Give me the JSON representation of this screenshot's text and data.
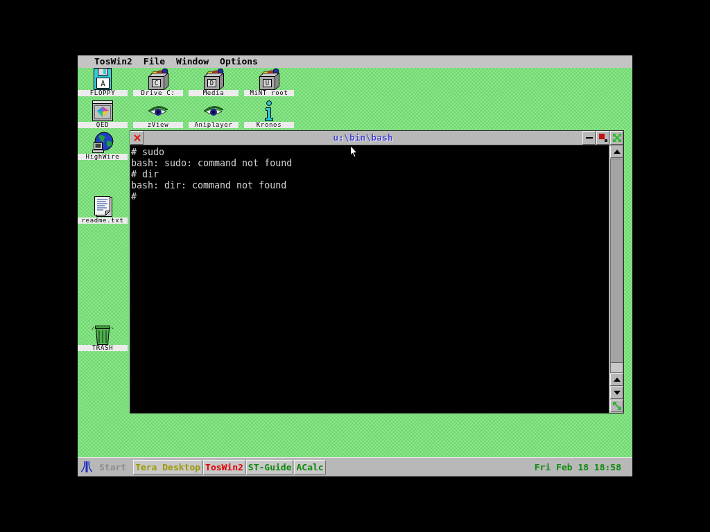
{
  "menu_bar": {
    "items": [
      "TosWin2",
      "File",
      "Window",
      "Options"
    ]
  },
  "desktop_icons": [
    {
      "label": "FLOPPY",
      "kind": "floppy",
      "letter": "A"
    },
    {
      "label": "Drive C:",
      "kind": "drive",
      "letter": "C"
    },
    {
      "label": "Media",
      "kind": "drive",
      "letter": "D"
    },
    {
      "label": "MiNT root",
      "kind": "drive",
      "letter": "U"
    },
    {
      "label": "QED",
      "kind": "editor"
    },
    {
      "label": "zView",
      "kind": "eye"
    },
    {
      "label": "Aniplayer",
      "kind": "eye"
    },
    {
      "label": "Kronos",
      "kind": "info"
    },
    {
      "label": "HighWire",
      "kind": "globe"
    },
    {
      "label": "readme.txt",
      "kind": "document"
    },
    {
      "label": "TRASH",
      "kind": "trash"
    }
  ],
  "window": {
    "title": "u:\\bin\\bash",
    "lines": [
      "# sudo",
      "bash: sudo: command not found",
      "# dir",
      "bash: dir: command not found",
      "#"
    ]
  },
  "taskbar": {
    "start": "Start",
    "tasks": [
      {
        "label": "Tera Desktop",
        "color": "#9a9a00"
      },
      {
        "label": "TosWin2",
        "color": "#e00000"
      },
      {
        "label": "ST-Guide",
        "color": "#0a8a0a"
      },
      {
        "label": "ACalc",
        "color": "#0a8a0a"
      }
    ],
    "clock": "Fri Feb 18 18:58"
  }
}
